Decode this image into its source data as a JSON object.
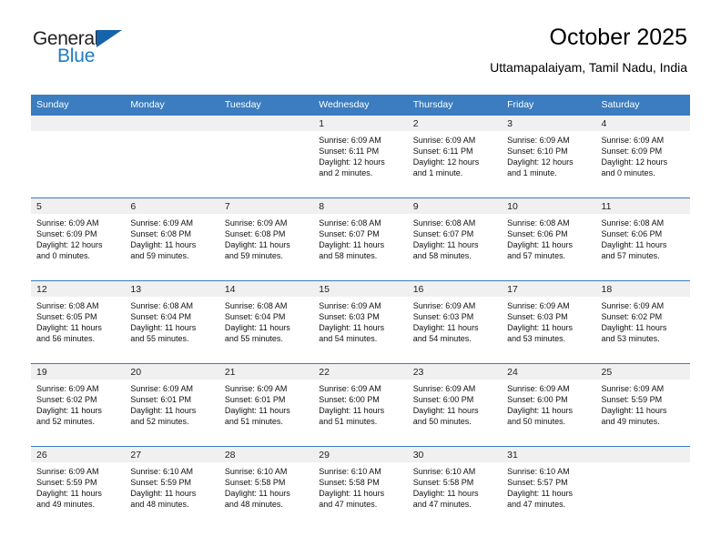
{
  "brand": {
    "name_part1": "General",
    "name_part2": "Blue"
  },
  "header": {
    "title": "October 2025",
    "subtitle": "Uttamapalaiyam, Tamil Nadu, India"
  },
  "colors": {
    "header_blue": "#3b7dc0",
    "logo_blue": "#1563a8",
    "band_gray": "#f0f0f0"
  },
  "weekday_headers": [
    "Sunday",
    "Monday",
    "Tuesday",
    "Wednesday",
    "Thursday",
    "Friday",
    "Saturday"
  ],
  "labels": {
    "sunrise_prefix": "Sunrise:",
    "sunset_prefix": "Sunset:",
    "daylight_prefix": "Daylight:"
  },
  "weeks": [
    [
      {
        "day": ""
      },
      {
        "day": ""
      },
      {
        "day": ""
      },
      {
        "day": "1",
        "sunrise": "Sunrise: 6:09 AM",
        "sunset": "Sunset: 6:11 PM",
        "daylight_line1": "Daylight: 12 hours",
        "daylight_line2": "and 2 minutes."
      },
      {
        "day": "2",
        "sunrise": "Sunrise: 6:09 AM",
        "sunset": "Sunset: 6:11 PM",
        "daylight_line1": "Daylight: 12 hours",
        "daylight_line2": "and 1 minute."
      },
      {
        "day": "3",
        "sunrise": "Sunrise: 6:09 AM",
        "sunset": "Sunset: 6:10 PM",
        "daylight_line1": "Daylight: 12 hours",
        "daylight_line2": "and 1 minute."
      },
      {
        "day": "4",
        "sunrise": "Sunrise: 6:09 AM",
        "sunset": "Sunset: 6:09 PM",
        "daylight_line1": "Daylight: 12 hours",
        "daylight_line2": "and 0 minutes."
      }
    ],
    [
      {
        "day": "5",
        "sunrise": "Sunrise: 6:09 AM",
        "sunset": "Sunset: 6:09 PM",
        "daylight_line1": "Daylight: 12 hours",
        "daylight_line2": "and 0 minutes."
      },
      {
        "day": "6",
        "sunrise": "Sunrise: 6:09 AM",
        "sunset": "Sunset: 6:08 PM",
        "daylight_line1": "Daylight: 11 hours",
        "daylight_line2": "and 59 minutes."
      },
      {
        "day": "7",
        "sunrise": "Sunrise: 6:09 AM",
        "sunset": "Sunset: 6:08 PM",
        "daylight_line1": "Daylight: 11 hours",
        "daylight_line2": "and 59 minutes."
      },
      {
        "day": "8",
        "sunrise": "Sunrise: 6:08 AM",
        "sunset": "Sunset: 6:07 PM",
        "daylight_line1": "Daylight: 11 hours",
        "daylight_line2": "and 58 minutes."
      },
      {
        "day": "9",
        "sunrise": "Sunrise: 6:08 AM",
        "sunset": "Sunset: 6:07 PM",
        "daylight_line1": "Daylight: 11 hours",
        "daylight_line2": "and 58 minutes."
      },
      {
        "day": "10",
        "sunrise": "Sunrise: 6:08 AM",
        "sunset": "Sunset: 6:06 PM",
        "daylight_line1": "Daylight: 11 hours",
        "daylight_line2": "and 57 minutes."
      },
      {
        "day": "11",
        "sunrise": "Sunrise: 6:08 AM",
        "sunset": "Sunset: 6:06 PM",
        "daylight_line1": "Daylight: 11 hours",
        "daylight_line2": "and 57 minutes."
      }
    ],
    [
      {
        "day": "12",
        "sunrise": "Sunrise: 6:08 AM",
        "sunset": "Sunset: 6:05 PM",
        "daylight_line1": "Daylight: 11 hours",
        "daylight_line2": "and 56 minutes."
      },
      {
        "day": "13",
        "sunrise": "Sunrise: 6:08 AM",
        "sunset": "Sunset: 6:04 PM",
        "daylight_line1": "Daylight: 11 hours",
        "daylight_line2": "and 55 minutes."
      },
      {
        "day": "14",
        "sunrise": "Sunrise: 6:08 AM",
        "sunset": "Sunset: 6:04 PM",
        "daylight_line1": "Daylight: 11 hours",
        "daylight_line2": "and 55 minutes."
      },
      {
        "day": "15",
        "sunrise": "Sunrise: 6:09 AM",
        "sunset": "Sunset: 6:03 PM",
        "daylight_line1": "Daylight: 11 hours",
        "daylight_line2": "and 54 minutes."
      },
      {
        "day": "16",
        "sunrise": "Sunrise: 6:09 AM",
        "sunset": "Sunset: 6:03 PM",
        "daylight_line1": "Daylight: 11 hours",
        "daylight_line2": "and 54 minutes."
      },
      {
        "day": "17",
        "sunrise": "Sunrise: 6:09 AM",
        "sunset": "Sunset: 6:03 PM",
        "daylight_line1": "Daylight: 11 hours",
        "daylight_line2": "and 53 minutes."
      },
      {
        "day": "18",
        "sunrise": "Sunrise: 6:09 AM",
        "sunset": "Sunset: 6:02 PM",
        "daylight_line1": "Daylight: 11 hours",
        "daylight_line2": "and 53 minutes."
      }
    ],
    [
      {
        "day": "19",
        "sunrise": "Sunrise: 6:09 AM",
        "sunset": "Sunset: 6:02 PM",
        "daylight_line1": "Daylight: 11 hours",
        "daylight_line2": "and 52 minutes."
      },
      {
        "day": "20",
        "sunrise": "Sunrise: 6:09 AM",
        "sunset": "Sunset: 6:01 PM",
        "daylight_line1": "Daylight: 11 hours",
        "daylight_line2": "and 52 minutes."
      },
      {
        "day": "21",
        "sunrise": "Sunrise: 6:09 AM",
        "sunset": "Sunset: 6:01 PM",
        "daylight_line1": "Daylight: 11 hours",
        "daylight_line2": "and 51 minutes."
      },
      {
        "day": "22",
        "sunrise": "Sunrise: 6:09 AM",
        "sunset": "Sunset: 6:00 PM",
        "daylight_line1": "Daylight: 11 hours",
        "daylight_line2": "and 51 minutes."
      },
      {
        "day": "23",
        "sunrise": "Sunrise: 6:09 AM",
        "sunset": "Sunset: 6:00 PM",
        "daylight_line1": "Daylight: 11 hours",
        "daylight_line2": "and 50 minutes."
      },
      {
        "day": "24",
        "sunrise": "Sunrise: 6:09 AM",
        "sunset": "Sunset: 6:00 PM",
        "daylight_line1": "Daylight: 11 hours",
        "daylight_line2": "and 50 minutes."
      },
      {
        "day": "25",
        "sunrise": "Sunrise: 6:09 AM",
        "sunset": "Sunset: 5:59 PM",
        "daylight_line1": "Daylight: 11 hours",
        "daylight_line2": "and 49 minutes."
      }
    ],
    [
      {
        "day": "26",
        "sunrise": "Sunrise: 6:09 AM",
        "sunset": "Sunset: 5:59 PM",
        "daylight_line1": "Daylight: 11 hours",
        "daylight_line2": "and 49 minutes."
      },
      {
        "day": "27",
        "sunrise": "Sunrise: 6:10 AM",
        "sunset": "Sunset: 5:59 PM",
        "daylight_line1": "Daylight: 11 hours",
        "daylight_line2": "and 48 minutes."
      },
      {
        "day": "28",
        "sunrise": "Sunrise: 6:10 AM",
        "sunset": "Sunset: 5:58 PM",
        "daylight_line1": "Daylight: 11 hours",
        "daylight_line2": "and 48 minutes."
      },
      {
        "day": "29",
        "sunrise": "Sunrise: 6:10 AM",
        "sunset": "Sunset: 5:58 PM",
        "daylight_line1": "Daylight: 11 hours",
        "daylight_line2": "and 47 minutes."
      },
      {
        "day": "30",
        "sunrise": "Sunrise: 6:10 AM",
        "sunset": "Sunset: 5:58 PM",
        "daylight_line1": "Daylight: 11 hours",
        "daylight_line2": "and 47 minutes."
      },
      {
        "day": "31",
        "sunrise": "Sunrise: 6:10 AM",
        "sunset": "Sunset: 5:57 PM",
        "daylight_line1": "Daylight: 11 hours",
        "daylight_line2": "and 47 minutes."
      },
      {
        "day": ""
      }
    ]
  ]
}
